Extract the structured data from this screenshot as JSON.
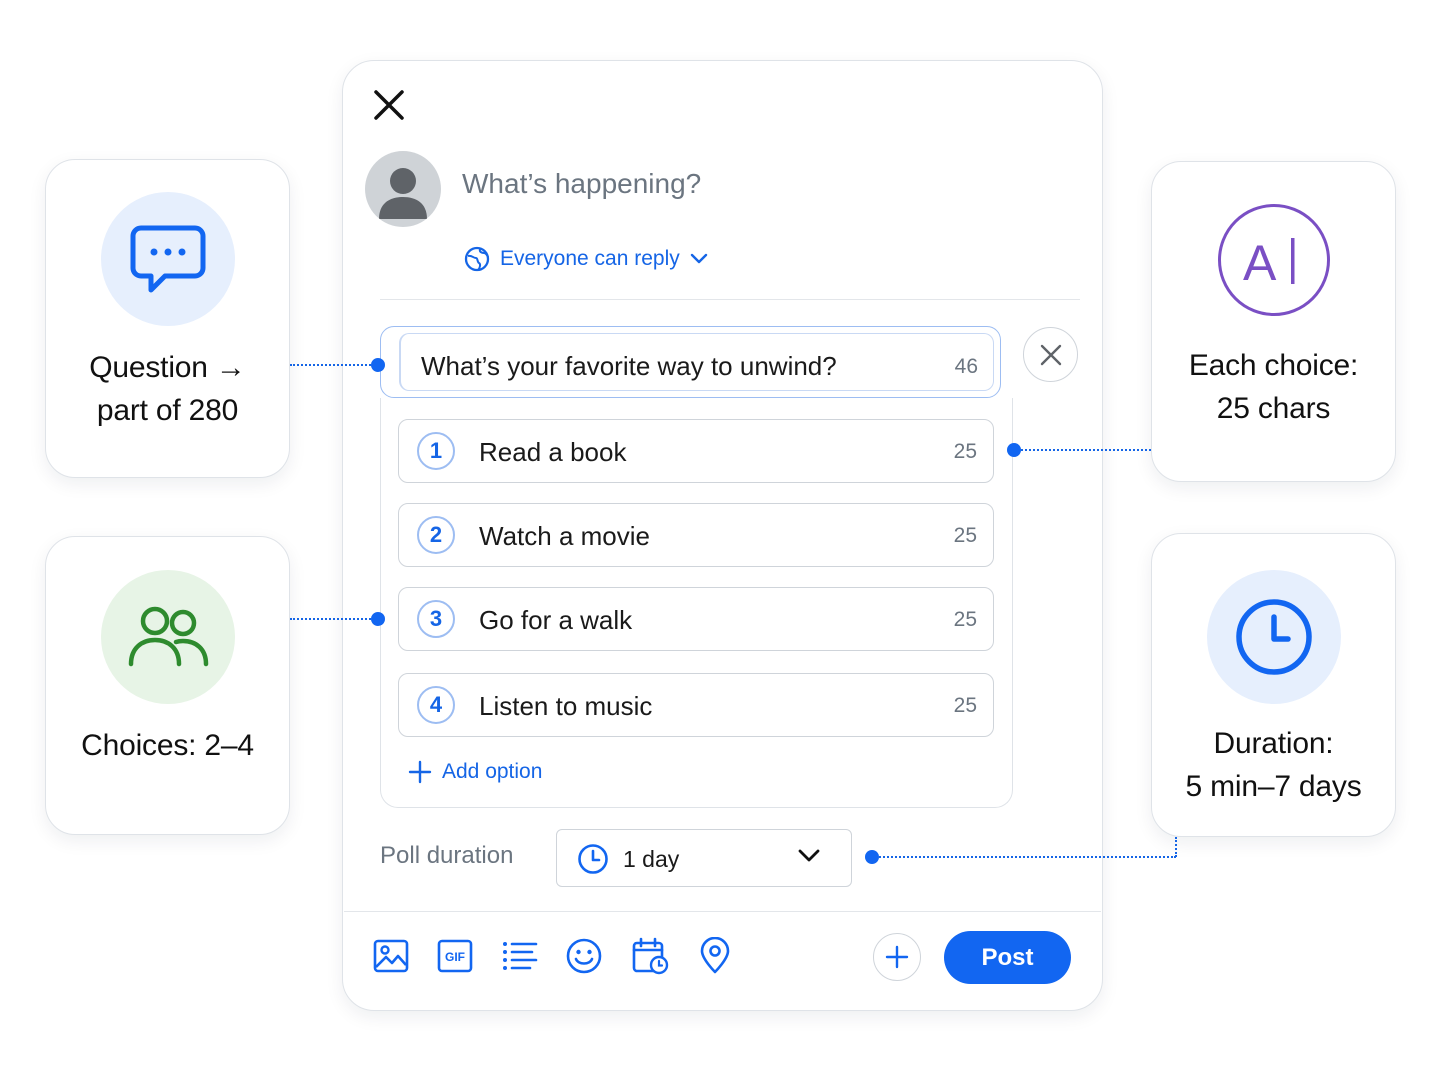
{
  "composer": {
    "placeholder": "What’s happening?",
    "reply_setting": "Everyone can reply",
    "question": {
      "text": "What’s your favorite way to unwind?",
      "counter": "46"
    },
    "choices": [
      {
        "number": "1",
        "text": "Read a book",
        "counter": "25"
      },
      {
        "number": "2",
        "text": "Watch a movie",
        "counter": "25"
      },
      {
        "number": "3",
        "text": "Go for a walk",
        "counter": "25"
      },
      {
        "number": "4",
        "text": "Listen to music",
        "counter": "25"
      }
    ],
    "add_option": "Add option",
    "poll_duration": {
      "label": "Poll duration",
      "value": "1 day"
    },
    "toolbar": {
      "icons": [
        "image-icon",
        "gif-icon",
        "poll-icon",
        "emoji-icon",
        "schedule-icon",
        "location-icon"
      ],
      "gif_text": "GIF",
      "post_label": "Post"
    }
  },
  "callouts": {
    "question": {
      "line1": "Question →",
      "line2": "part of 280",
      "icon": "chat-bubble-icon"
    },
    "choices": {
      "line1": "Choices: 2–4",
      "icon": "users-icon"
    },
    "each_choice": {
      "line1": "Each choice:",
      "line2": "25 chars",
      "icon": "text-cursor-icon",
      "glyph": "A"
    },
    "duration": {
      "line1": "Duration:",
      "line2": "5 min–7 days",
      "icon": "clock-icon"
    }
  },
  "colors": {
    "accent": "#1266f1",
    "question_bg": "#e6effd",
    "choices_bg": "#e7f4e6",
    "choices_icon": "#2e8b2e",
    "each_choice_icon": "#7a4fc4",
    "duration_bg": "#e6effd"
  }
}
